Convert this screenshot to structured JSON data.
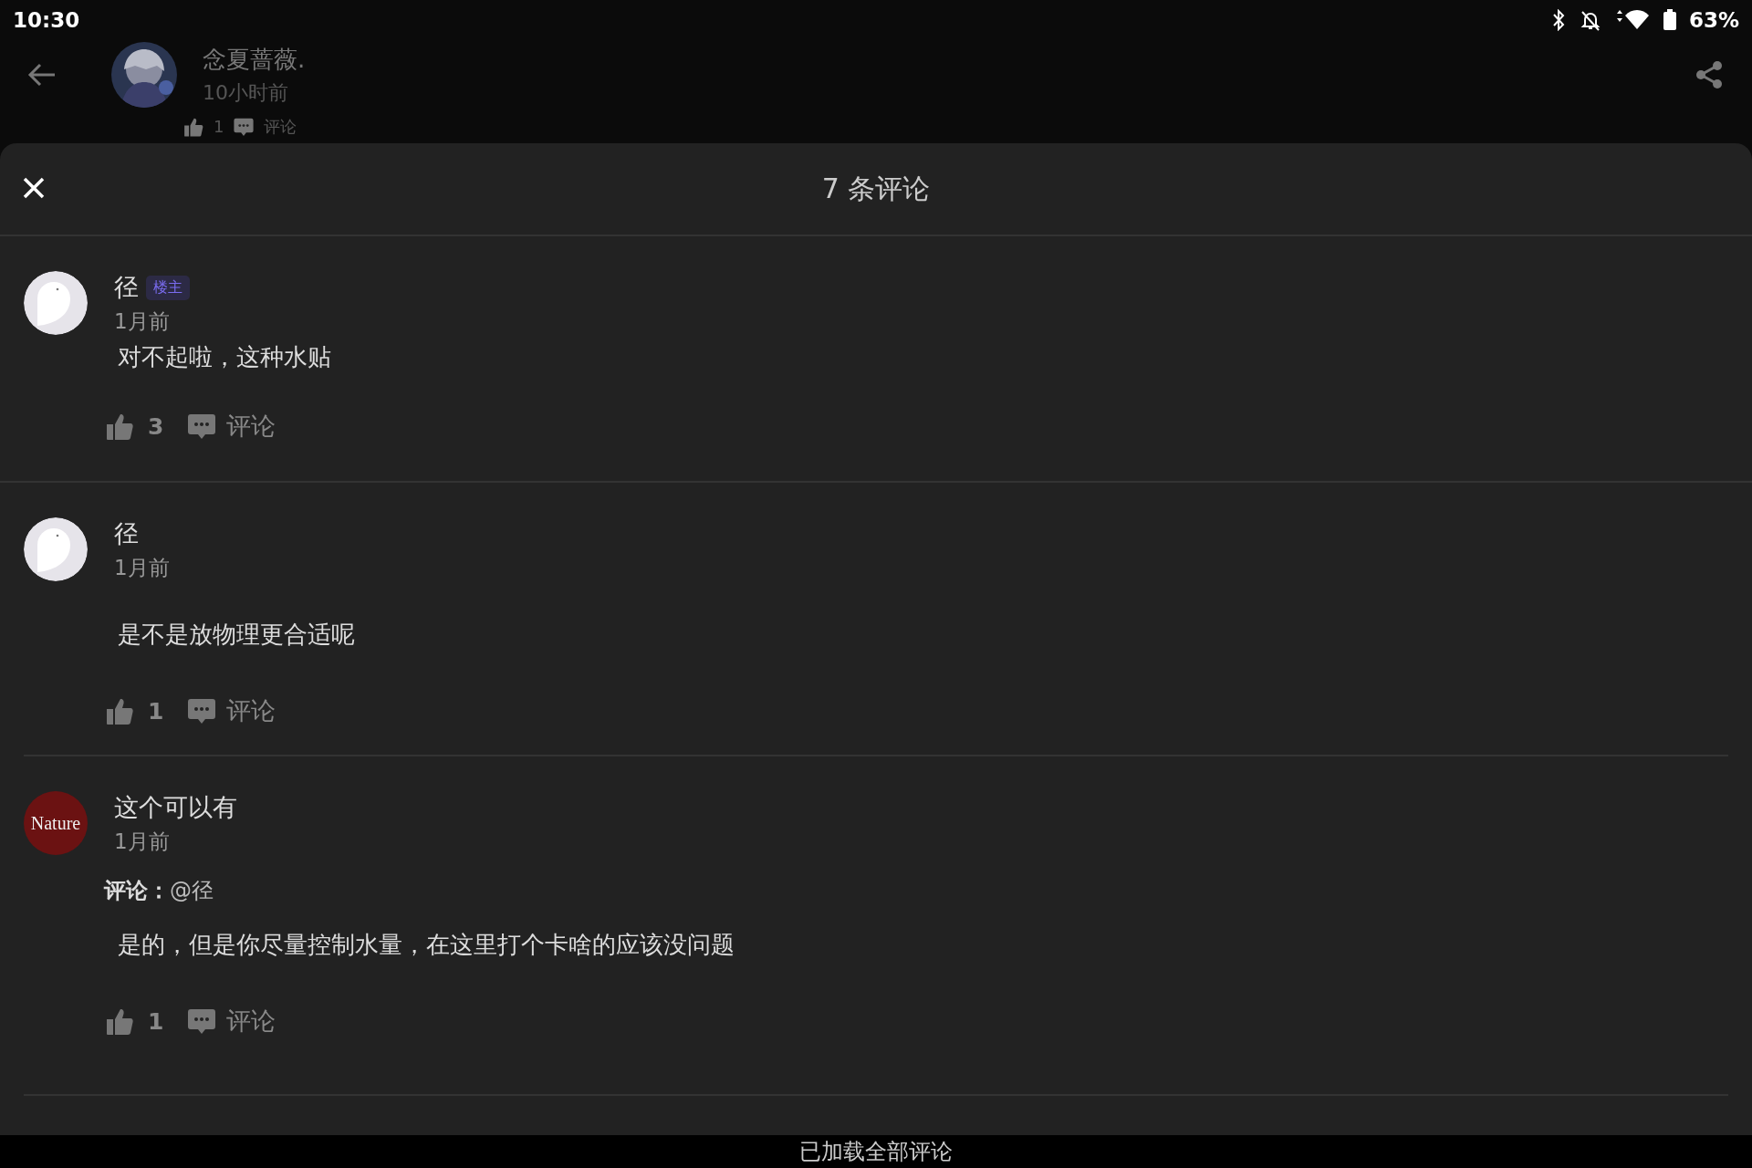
{
  "status_bar": {
    "time": "10:30",
    "battery": "63%"
  },
  "post": {
    "author": "念夏蔷薇.",
    "time": "10小时前",
    "likes": "1",
    "comment_label": "评论"
  },
  "sheet": {
    "title": "7 条评论",
    "comments": [
      {
        "author": "径",
        "badge": "楼主",
        "time": "1月前",
        "avatar": {
          "kind": "bird"
        },
        "text": "对不起啦，这种水贴",
        "likes": "3",
        "comment_label": "评论"
      },
      {
        "author": "径",
        "time": "1月前",
        "avatar": {
          "kind": "bird"
        },
        "text": "是不是放物理更合适呢",
        "likes": "1",
        "comment_label": "评论"
      },
      {
        "author": "这个可以有",
        "time": "1月前",
        "avatar": {
          "kind": "text",
          "label": "Nature"
        },
        "reply": "**评论：**@径",
        "text": "是的，但是你尽量控制水量，在这里打个卡啥的应该没问题",
        "likes": "1",
        "comment_label": "评论"
      }
    ]
  },
  "footer": "已加载全部评论"
}
